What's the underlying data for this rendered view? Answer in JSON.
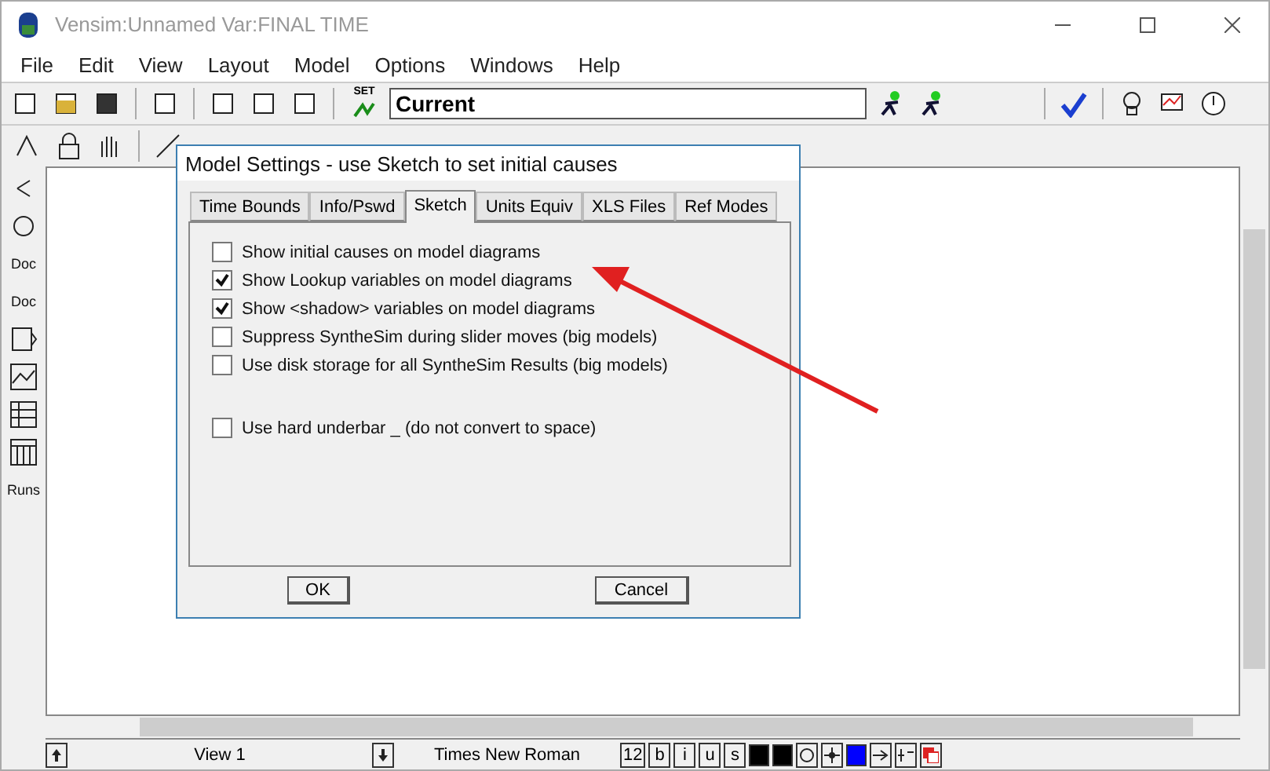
{
  "window": {
    "title": "Vensim:Unnamed Var:FINAL TIME"
  },
  "menu": [
    "File",
    "Edit",
    "View",
    "Layout",
    "Model",
    "Options",
    "Windows",
    "Help"
  ],
  "toolbar": {
    "set_label": "SET",
    "run_name": "Current"
  },
  "sidebar_labels": [
    "Doc",
    "Doc",
    "Runs"
  ],
  "status_bar": {
    "view": "View 1",
    "font": "Times New Roman",
    "size": "12",
    "styles": [
      "b",
      "i",
      "u",
      "s"
    ]
  },
  "dialog": {
    "title": "Model Settings - use Sketch to set initial causes",
    "tabs": [
      {
        "label": "Time Bounds",
        "selected": false
      },
      {
        "label": "Info/Pswd",
        "selected": false
      },
      {
        "label": "Sketch",
        "selected": true
      },
      {
        "label": "Units Equiv",
        "selected": false
      },
      {
        "label": "XLS Files",
        "selected": false
      },
      {
        "label": "Ref Modes",
        "selected": false
      }
    ],
    "options": [
      {
        "label": "Show initial causes on model diagrams",
        "checked": false
      },
      {
        "label": "Show Lookup variables on model diagrams",
        "checked": true
      },
      {
        "label": "Show <shadow> variables on model diagrams",
        "checked": true
      },
      {
        "label": "Suppress SyntheSim during slider moves (big models)",
        "checked": false
      },
      {
        "label": "Use disk storage for all SyntheSim Results (big models)",
        "checked": false
      }
    ],
    "extra_options": [
      {
        "label": "Use hard underbar _ (do not convert to space)",
        "checked": false
      }
    ],
    "buttons": [
      "OK",
      "Cancel"
    ]
  }
}
